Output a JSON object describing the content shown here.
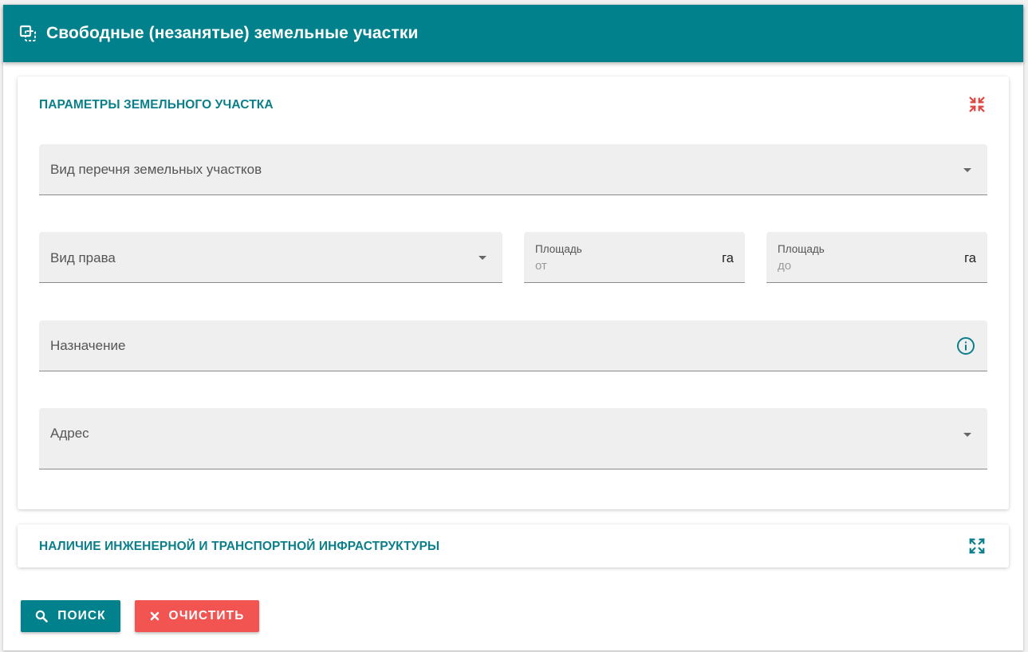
{
  "header": {
    "title": "Свободные (незанятые) земельные участки",
    "icon": "copy-icon"
  },
  "colors": {
    "primary": "#01818c",
    "danger": "#f25452",
    "collapse_icon": "#e0453f",
    "field_bg": "#efefef"
  },
  "params_panel": {
    "title": "ПАРАМЕТРЫ ЗЕМЕЛЬНОГО УЧАСТКА",
    "toggle_icon": "collapse-icon",
    "fields": {
      "list_type": {
        "label": "Вид перечня земельных участков"
      },
      "right_type": {
        "label": "Вид права"
      },
      "area_from": {
        "caption": "Площадь",
        "placeholder": "от",
        "unit": "га",
        "value": ""
      },
      "area_to": {
        "caption": "Площадь",
        "placeholder": "до",
        "unit": "га",
        "value": ""
      },
      "purpose": {
        "label": "Назначение",
        "icon": "info-icon"
      },
      "address": {
        "label": "Адрес"
      }
    }
  },
  "infra_panel": {
    "title": "НАЛИЧИЕ ИНЖЕНЕРНОЙ И ТРАНСПОРТНОЙ ИНФРАСТРУКТУРЫ",
    "toggle_icon": "expand-icon"
  },
  "actions": {
    "search_label": "ПОИСК",
    "clear_label": "ОЧИСТИТЬ"
  }
}
